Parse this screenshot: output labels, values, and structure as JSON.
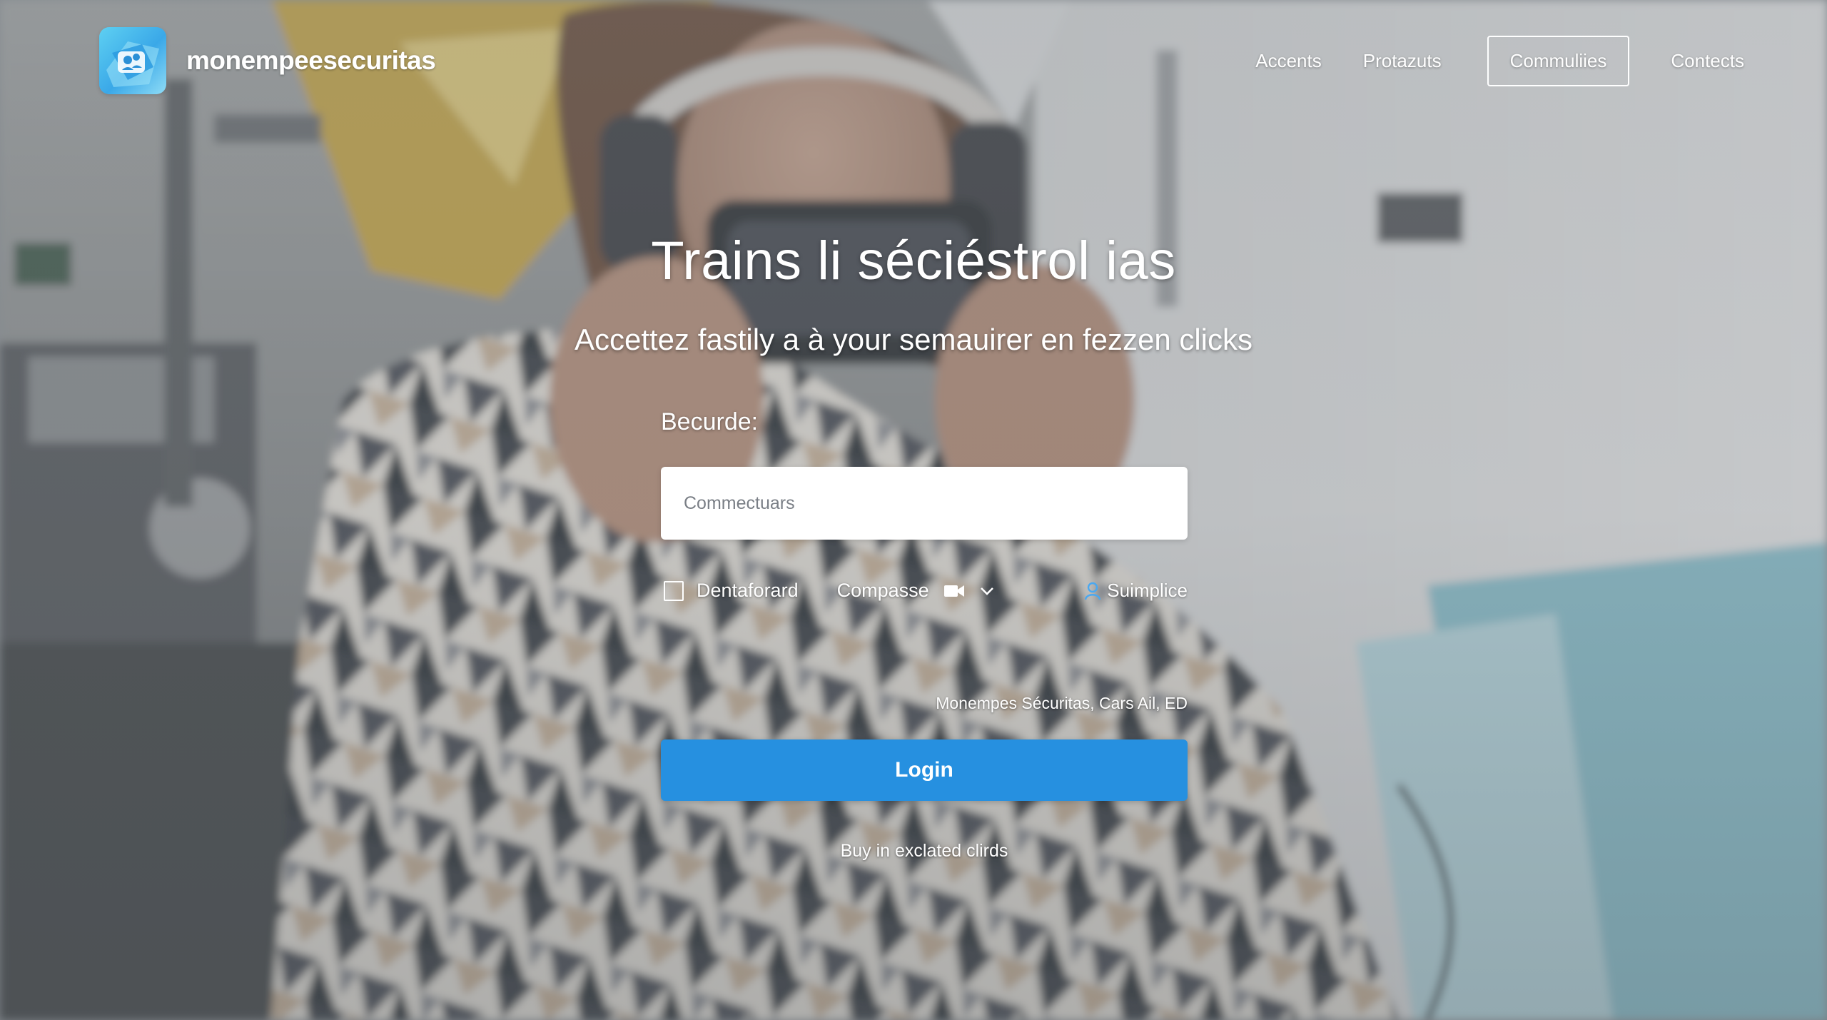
{
  "brand": {
    "name": "monempeesecuritas",
    "logo_icon": "people-chat-logo-icon"
  },
  "nav": {
    "items": [
      {
        "label": "Accents"
      },
      {
        "label": "Protazuts"
      },
      {
        "label": "Commuliies",
        "active": true
      },
      {
        "label": "Contects"
      }
    ]
  },
  "hero": {
    "title": "Trains li séciéstrol ias",
    "subtitle": "Accettez fastily a à your semauirer en fezzen clicks"
  },
  "form": {
    "label": "Becurde:",
    "input": {
      "placeholder": "Commectuars",
      "value": ""
    },
    "remember": {
      "label": "Dentaforard",
      "checked": false
    },
    "select": {
      "value": "Compasse",
      "icon": "video-camera-icon"
    },
    "link": {
      "label": "Suimplice",
      "icon": "user-icon"
    },
    "footnote": "Monempes Sécuritas, Cars Ail, ED",
    "submit_label": "Login",
    "bottom_link": "Buy in exclated clirds"
  },
  "colors": {
    "accent": "#2690e0",
    "text": "#ffffff",
    "logo": "#3aa8e8"
  }
}
